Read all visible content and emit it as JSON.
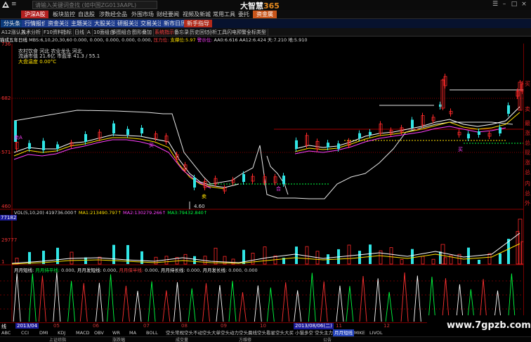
{
  "app": {
    "title_prefix": "大智慧",
    "title_suffix": "365",
    "search_placeholder": "请输入关键词查找 (如中国ZG013AAPL)"
  },
  "main_menu": {
    "items": [
      "沪深A股",
      "板块监控",
      "自选股",
      "涉数经全品",
      "外围市场",
      "财经要闻",
      "视频及新城",
      "常用工具",
      "委托",
      "资金属"
    ],
    "active_index": 0,
    "hot_index": 9
  },
  "quick_bar": {
    "items": [
      "分头条",
      "行情报价",
      "资金关注",
      "主题关注",
      "大股关注",
      "研报关注",
      "交易关注",
      "新市日历",
      "新手指导"
    ],
    "highlight_index": 8
  },
  "toolbar": {
    "items": [
      "A12涨认入",
      "技术分析",
      "F10资料",
      "指标",
      "日线",
      "A",
      "10面组合",
      "多图组合",
      "图形叠加",
      "系统指示",
      "备忘录",
      "历史回忆",
      "分析工具",
      "闪电预警",
      "全标类型"
    ]
  },
  "indicator_line": {
    "name": "猫成五年日线",
    "params": "MBS:6,10,20,30,60",
    "values": "0.000, 0.000, 0.000, 0.000, 0.000,",
    "pressure_label": "压力位:",
    "support_label": "支撑位:",
    "support_val": "5.97",
    "warning_label": "警示位:",
    "aa0_label": "AA0:",
    "aa0_val": "6.616",
    "aa12_label": "AA12:",
    "aa12_val": "6.424",
    "sky_label": "天:",
    "sky_val": "7.210",
    "ground_label": "地:",
    "ground_val": "5.910"
  },
  "info_panel": {
    "line1": "农村饮食 河北 农业龙头 河北",
    "line2": "流通市值 21.6亿   市盈率 41.3 / 55.1",
    "line3": "大盘温度 0.00°C"
  },
  "price_axis": [
    "736",
    "682",
    "571",
    "460"
  ],
  "price_markers": {
    "low": "4.60",
    "signals": [
      "卖A",
      "买",
      "卖",
      "合",
      "买"
    ]
  },
  "volume": {
    "legend_prefix": "VOL(5,10,20)",
    "legend_val": "419736.000↑",
    "ma1_label": "MA1:",
    "ma1_val": "213490.797↑",
    "ma2_label": "MA2:",
    "ma2_val": "130279.266↑",
    "ma3_label": "MA3:",
    "ma3_val": "79432.840↑",
    "axis": [
      "77182",
      "29777",
      "1"
    ]
  },
  "oscillator": {
    "labels": [
      "月月短线:",
      "月月持平线:",
      "0.000,",
      "月月发短线:",
      "0.000,",
      "月月保半线:",
      "0.000,",
      "月月持长线:",
      "0.000,",
      "月月发长线:",
      "0.000,",
      "0.000"
    ]
  },
  "dates": [
    "2013/04",
    "05",
    "06",
    "07",
    "08",
    "09",
    "10",
    "11",
    "12",
    "2013/08/06(二)",
    "11",
    "12"
  ],
  "date_cursor": "2013/08/06(二)",
  "tabs": [
    "ABC",
    "CCI",
    "DMI",
    "KDJ",
    "MACD",
    "OBV",
    "WR",
    "MA",
    "BOLL",
    "空头常规",
    "空头不动",
    "空头大单",
    "空头动力",
    "空头晨线",
    "空头看星",
    "空头大买",
    "小猫多空",
    "空头主力",
    "月月短线",
    "MIKE",
    "LIVOL"
  ],
  "active_tab": "月月短线",
  "status": [
    "上证综指",
    "涨跌幅",
    "成交量",
    "方维修",
    "公告"
  ],
  "watermark": "www.7gpzb.com",
  "right_strip": [
    "买",
    "卖",
    "最",
    "涨",
    "总",
    "现",
    "涨",
    "总",
    "内",
    "总",
    "外"
  ],
  "colors": {
    "up": "#ff2a2a",
    "down": "#30e6e6",
    "ma_white": "#ffffff",
    "ma_yellow": "#ffe000",
    "ma_magenta": "#ff40ff",
    "ma_green": "#00ff40",
    "grid_red": "#8a0000"
  }
}
